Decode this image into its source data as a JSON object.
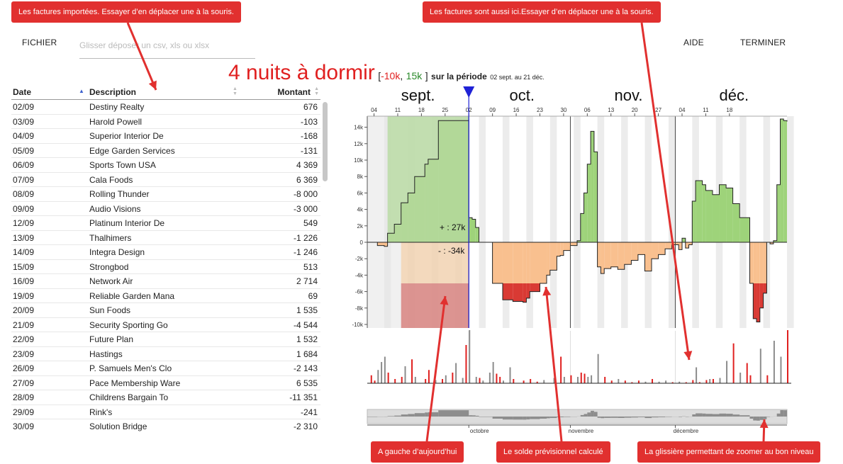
{
  "callouts": {
    "imported": "Les factures importées. Essayer d’en déplacer une à la souris.",
    "also_here": "Les factures sont aussi ici.Essayer d’en déplacer une à la souris.",
    "left_today": "A gauche d’aujourd’hui",
    "balance": "Le solde prévisionnel calculé",
    "slider": "La glissière permettant de zoomer au bon niveau"
  },
  "menu": {
    "file": "FICHIER",
    "help": "AIDE",
    "finish": "TERMINER"
  },
  "dropzone": {
    "placeholder": "Glisser déposer un csv, xls ou xlsx"
  },
  "table": {
    "headers": {
      "date": "Date",
      "description": "Description",
      "amount": "Montant"
    },
    "rows": [
      {
        "date": "02/09",
        "desc": "Destiny Realty",
        "amount": "676"
      },
      {
        "date": "03/09",
        "desc": "Harold Powell",
        "amount": "-103"
      },
      {
        "date": "04/09",
        "desc": "Superior Interior De",
        "amount": "-168"
      },
      {
        "date": "05/09",
        "desc": "Edge Garden Services",
        "amount": "-131"
      },
      {
        "date": "06/09",
        "desc": "Sports Town USA",
        "amount": "4 369"
      },
      {
        "date": "07/09",
        "desc": "Cala Foods",
        "amount": "6 369"
      },
      {
        "date": "08/09",
        "desc": "Rolling Thunder",
        "amount": "-8 000"
      },
      {
        "date": "09/09",
        "desc": "Audio Visions",
        "amount": "-3 000"
      },
      {
        "date": "12/09",
        "desc": "Platinum Interior De",
        "amount": "549"
      },
      {
        "date": "13/09",
        "desc": "Thalhimers",
        "amount": "-1 226"
      },
      {
        "date": "14/09",
        "desc": "Integra Design",
        "amount": "-1 246"
      },
      {
        "date": "15/09",
        "desc": "Strongbod",
        "amount": "513"
      },
      {
        "date": "16/09",
        "desc": "Network Air",
        "amount": "2 714"
      },
      {
        "date": "19/09",
        "desc": "Reliable Garden Mana",
        "amount": "69"
      },
      {
        "date": "20/09",
        "desc": "Sun Foods",
        "amount": "1 535"
      },
      {
        "date": "21/09",
        "desc": "Security Sporting Go",
        "amount": "-4 544"
      },
      {
        "date": "22/09",
        "desc": "Future Plan",
        "amount": "1 532"
      },
      {
        "date": "23/09",
        "desc": "Hastings",
        "amount": "1 684"
      },
      {
        "date": "26/09",
        "desc": "P. Samuels Men's Clo",
        "amount": "-2 143"
      },
      {
        "date": "27/09",
        "desc": "Pace Membership Ware",
        "amount": "6 535"
      },
      {
        "date": "28/09",
        "desc": "Childrens Bargain To",
        "amount": "-11 351"
      },
      {
        "date": "29/09",
        "desc": "Rink's",
        "amount": "-241"
      },
      {
        "date": "30/09",
        "desc": "Solution Bridge",
        "amount": "-2 310"
      }
    ]
  },
  "headline": {
    "nights": "4 nuits à dormir",
    "open": "[",
    "min": "-10k",
    "sep": ",",
    "max": "15k",
    "close": "]",
    "period_label": "sur la période",
    "period_dates": "02 sept. au 21 déc."
  },
  "chart_data": {
    "type": "area",
    "months": [
      "sept.",
      "oct.",
      "nov.",
      "déc."
    ],
    "x_ticks": [
      "04",
      "11",
      "18",
      "25",
      "02",
      "09",
      "16",
      "23",
      "30",
      "06",
      "13",
      "20",
      "27",
      "04",
      "11",
      "18"
    ],
    "y_ticks": [
      "14k",
      "12k",
      "10k",
      "8k",
      "6k",
      "4k",
      "2k",
      "0",
      "-2k",
      "-4k",
      "-6k",
      "-8k",
      "-10k"
    ],
    "ylim": [
      -10000,
      15000
    ],
    "positive_total_label": "+ : 27k",
    "negative_total_label": "- : -34k",
    "today": "02 oct.",
    "balance_series": [
      [
        0,
        0
      ],
      [
        3,
        -400
      ],
      [
        5,
        -500
      ],
      [
        6,
        1100
      ],
      [
        8,
        2200
      ],
      [
        10,
        4800
      ],
      [
        12,
        6000
      ],
      [
        14,
        8000
      ],
      [
        17,
        9500
      ],
      [
        18,
        10100
      ],
      [
        21,
        14800
      ],
      [
        30,
        14800
      ],
      [
        30,
        3000
      ],
      [
        31,
        2800
      ],
      [
        32,
        1800
      ],
      [
        33,
        0
      ],
      [
        37,
        -5000
      ],
      [
        40,
        -7000
      ],
      [
        43,
        -7200
      ],
      [
        46,
        -7300
      ],
      [
        47,
        -6800
      ],
      [
        48,
        -6000
      ],
      [
        51,
        -5000
      ],
      [
        53,
        -4000
      ],
      [
        54,
        -3400
      ],
      [
        56,
        -1700
      ],
      [
        57,
        -1600
      ],
      [
        58,
        -1000
      ],
      [
        60,
        -400
      ],
      [
        62,
        200
      ],
      [
        63,
        3500
      ],
      [
        64,
        6000
      ],
      [
        65,
        9500
      ],
      [
        66,
        13500
      ],
      [
        67,
        11000
      ],
      [
        68,
        9200
      ],
      [
        68,
        -3000
      ],
      [
        69,
        -3800
      ],
      [
        70,
        -3200
      ],
      [
        72,
        -3000
      ],
      [
        74,
        -3300
      ],
      [
        76,
        -2700
      ],
      [
        78,
        -2200
      ],
      [
        80,
        -1500
      ],
      [
        82,
        -3500
      ],
      [
        84,
        -2000
      ],
      [
        86,
        -1500
      ],
      [
        88,
        -800
      ],
      [
        90,
        -300
      ],
      [
        92,
        -900
      ],
      [
        93,
        500
      ],
      [
        94,
        -700
      ],
      [
        95,
        -300
      ],
      [
        96,
        5000
      ],
      [
        97,
        7500
      ],
      [
        99,
        7000
      ],
      [
        100,
        6300
      ],
      [
        102,
        5800
      ],
      [
        104,
        7000
      ],
      [
        106,
        6600
      ],
      [
        108,
        4700
      ],
      [
        110,
        3000
      ],
      [
        113,
        -5000
      ],
      [
        114,
        -9300
      ],
      [
        115,
        -9700
      ],
      [
        116,
        -8000
      ],
      [
        117,
        -6200
      ],
      [
        118,
        0
      ],
      [
        119,
        -200
      ],
      [
        120,
        200
      ],
      [
        121,
        7000
      ],
      [
        122,
        15000
      ],
      [
        123,
        14800
      ],
      [
        124,
        14700
      ]
    ],
    "invoice_bars": [
      {
        "x": 1,
        "v": 0.15,
        "c": "red"
      },
      {
        "x": 2,
        "v": 0.05,
        "c": "red"
      },
      {
        "x": 3,
        "v": 0.25,
        "c": "grey"
      },
      {
        "x": 4,
        "v": 0.4,
        "c": "grey"
      },
      {
        "x": 5,
        "v": 0.5,
        "c": "grey"
      },
      {
        "x": 6,
        "v": 0.2,
        "c": "red"
      },
      {
        "x": 8,
        "v": 0.08,
        "c": "red"
      },
      {
        "x": 10,
        "v": 0.12,
        "c": "red"
      },
      {
        "x": 11,
        "v": 0.32,
        "c": "grey"
      },
      {
        "x": 13,
        "v": 0.45,
        "c": "red"
      },
      {
        "x": 14,
        "v": 0.12,
        "c": "grey"
      },
      {
        "x": 17,
        "v": 0.08,
        "c": "red"
      },
      {
        "x": 18,
        "v": 0.25,
        "c": "red"
      },
      {
        "x": 20,
        "v": 0.06,
        "c": "grey"
      },
      {
        "x": 22,
        "v": 0.08,
        "c": "red"
      },
      {
        "x": 23,
        "v": 0.15,
        "c": "grey"
      },
      {
        "x": 25,
        "v": 0.2,
        "c": "red"
      },
      {
        "x": 26,
        "v": 0.38,
        "c": "grey"
      },
      {
        "x": 28,
        "v": 0.1,
        "c": "grey"
      },
      {
        "x": 29,
        "v": 0.72,
        "c": "red"
      },
      {
        "x": 30,
        "v": 1.0,
        "c": "grey"
      },
      {
        "x": 32,
        "v": 0.12,
        "c": "grey"
      },
      {
        "x": 33,
        "v": 0.1,
        "c": "red"
      },
      {
        "x": 34,
        "v": 0.05,
        "c": "grey"
      },
      {
        "x": 36,
        "v": 0.2,
        "c": "grey"
      },
      {
        "x": 37,
        "v": 0.4,
        "c": "grey"
      },
      {
        "x": 38,
        "v": 0.18,
        "c": "red"
      },
      {
        "x": 39,
        "v": 0.12,
        "c": "red"
      },
      {
        "x": 40,
        "v": 0.05,
        "c": "grey"
      },
      {
        "x": 42,
        "v": 0.3,
        "c": "grey"
      },
      {
        "x": 43,
        "v": 0.08,
        "c": "red"
      },
      {
        "x": 46,
        "v": 0.05,
        "c": "red"
      },
      {
        "x": 48,
        "v": 0.08,
        "c": "red"
      },
      {
        "x": 50,
        "v": 0.03,
        "c": "red"
      },
      {
        "x": 52,
        "v": 0.06,
        "c": "grey"
      },
      {
        "x": 55,
        "v": 0.1,
        "c": "grey"
      },
      {
        "x": 57,
        "v": 0.5,
        "c": "red"
      },
      {
        "x": 58,
        "v": 0.12,
        "c": "grey"
      },
      {
        "x": 60,
        "v": 0.15,
        "c": "red"
      },
      {
        "x": 62,
        "v": 0.12,
        "c": "grey"
      },
      {
        "x": 63,
        "v": 0.2,
        "c": "red"
      },
      {
        "x": 64,
        "v": 0.18,
        "c": "red"
      },
      {
        "x": 65,
        "v": 0.12,
        "c": "grey"
      },
      {
        "x": 66,
        "v": 0.15,
        "c": "grey"
      },
      {
        "x": 68,
        "v": 0.55,
        "c": "grey"
      },
      {
        "x": 70,
        "v": 0.12,
        "c": "red"
      },
      {
        "x": 72,
        "v": 0.05,
        "c": "red"
      },
      {
        "x": 74,
        "v": 0.08,
        "c": "grey"
      },
      {
        "x": 76,
        "v": 0.05,
        "c": "red"
      },
      {
        "x": 78,
        "v": 0.02,
        "c": "red"
      },
      {
        "x": 80,
        "v": 0.05,
        "c": "red"
      },
      {
        "x": 82,
        "v": 0.03,
        "c": "grey"
      },
      {
        "x": 84,
        "v": 0.08,
        "c": "red"
      },
      {
        "x": 86,
        "v": 0.03,
        "c": "grey"
      },
      {
        "x": 88,
        "v": 0.05,
        "c": "grey"
      },
      {
        "x": 90,
        "v": 0.02,
        "c": "red"
      },
      {
        "x": 92,
        "v": 0.03,
        "c": "grey"
      },
      {
        "x": 94,
        "v": 0.02,
        "c": "red"
      },
      {
        "x": 96,
        "v": 0.06,
        "c": "red"
      },
      {
        "x": 97,
        "v": 0.3,
        "c": "grey"
      },
      {
        "x": 98,
        "v": 0.02,
        "c": "red"
      },
      {
        "x": 100,
        "v": 0.06,
        "c": "red"
      },
      {
        "x": 101,
        "v": 0.08,
        "c": "grey"
      },
      {
        "x": 102,
        "v": 0.08,
        "c": "red"
      },
      {
        "x": 104,
        "v": 0.1,
        "c": "grey"
      },
      {
        "x": 106,
        "v": 0.42,
        "c": "grey"
      },
      {
        "x": 108,
        "v": 0.75,
        "c": "red"
      },
      {
        "x": 110,
        "v": 0.2,
        "c": "grey"
      },
      {
        "x": 112,
        "v": 0.38,
        "c": "red"
      },
      {
        "x": 113,
        "v": 0.15,
        "c": "red"
      },
      {
        "x": 116,
        "v": 0.65,
        "c": "grey"
      },
      {
        "x": 118,
        "v": 0.15,
        "c": "red"
      },
      {
        "x": 120,
        "v": 0.8,
        "c": "grey"
      },
      {
        "x": 122,
        "v": 0.5,
        "c": "grey"
      },
      {
        "x": 124,
        "v": 1.0,
        "c": "red"
      }
    ],
    "brush_labels": [
      "octobre",
      "novembre",
      "décembre"
    ]
  },
  "colors": {
    "positive": "#9ed37a",
    "negative": "#f9c08f",
    "danger": "#d93a34",
    "today_marker": "#1f22d6",
    "callout": "#e1302f"
  }
}
